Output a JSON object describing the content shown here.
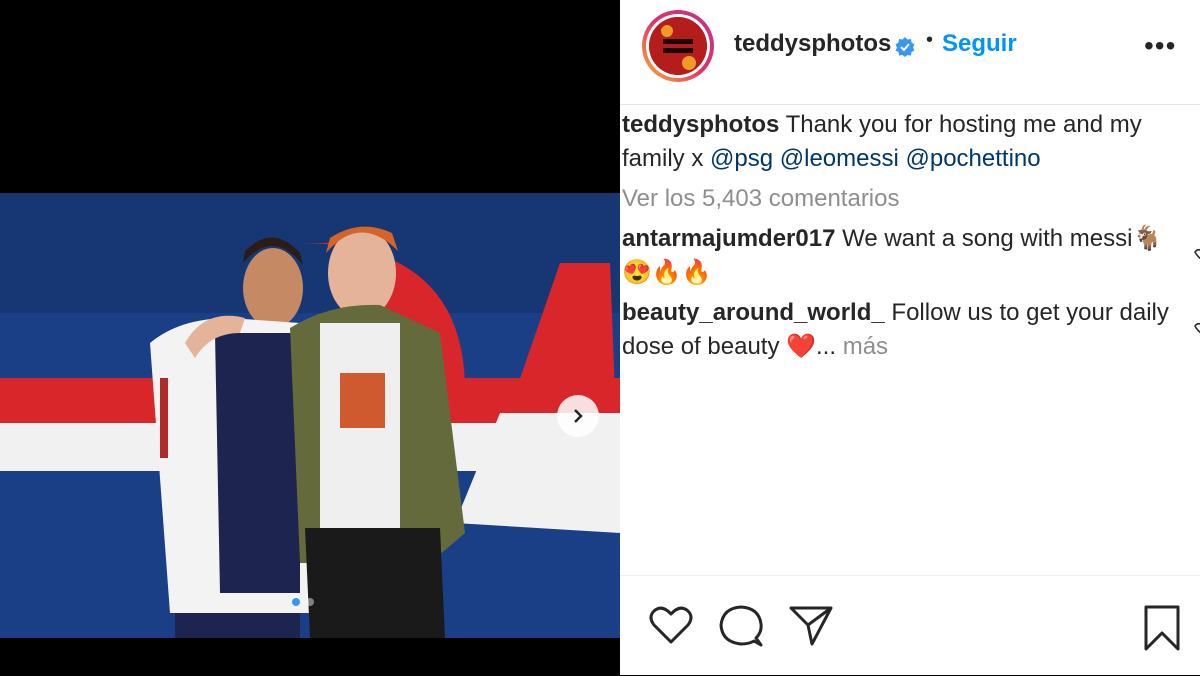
{
  "post": {
    "username": "teddysphotos",
    "separator": "•",
    "follow_label": "Seguir",
    "more_label": "•••"
  },
  "caption": {
    "username": "teddysphotos",
    "text": "Thank you for hosting me and my",
    "text2": "family x",
    "mention1": "@psg",
    "mention2": "@leomessi",
    "mention3": "@pochettino"
  },
  "view_comments": "Ver los 5,403 comentarios",
  "comments": [
    {
      "username": "antarmajumder017",
      "text": "We want a song with messi",
      "emoji_line2": "😍🔥🔥",
      "emoji_goat": "🐐"
    },
    {
      "username": "beauty_around_world_",
      "text": "Follow us to get your daily",
      "text2": "dose of beauty",
      "heart": "❤️",
      "ellipsis": "...",
      "more": "más"
    }
  ],
  "carousel": {
    "dots": 2,
    "active": 1
  },
  "icons": [
    "heart-icon",
    "comment-icon",
    "share-icon",
    "bookmark-icon",
    "verified-icon",
    "chevron-right-icon"
  ],
  "colors": {
    "follow": "#0095f6",
    "mention": "#00376b",
    "verified": "#3897f0"
  }
}
